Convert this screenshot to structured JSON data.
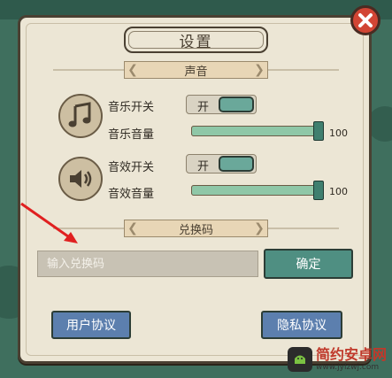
{
  "settings": {
    "title": "设置",
    "close_icon": "close-icon",
    "sound_section": "声音",
    "music_toggle_label": "音乐开关",
    "music_toggle_state": "开",
    "music_volume_label": "音乐音量",
    "music_volume_value": "100",
    "music_volume_level": 1.0,
    "sfx_toggle_label": "音效开关",
    "sfx_toggle_state": "开",
    "sfx_volume_label": "音效音量",
    "sfx_volume_value": "100",
    "sfx_volume_level": 1.0,
    "redeem_section": "兑换码",
    "redeem_placeholder": "输入兑换码",
    "confirm_label": "确定",
    "user_agreement_label": "用户协议",
    "privacy_agreement_label": "隐私协议"
  },
  "watermark": {
    "name": "简约安卓网",
    "url": "www.jylzwj.com"
  },
  "colors": {
    "panel": "#ece6d5",
    "accent_green": "#4f8f82",
    "blue_button": "#5c7fae",
    "close_red": "#d24534",
    "annotation_arrow": "#e02020"
  }
}
